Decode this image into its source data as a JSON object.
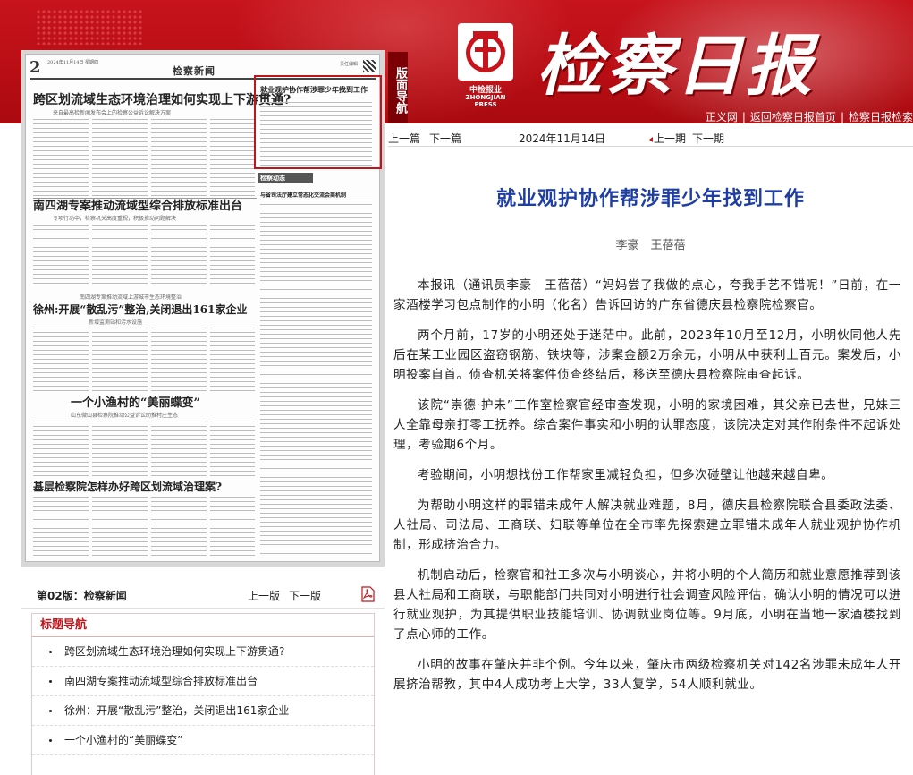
{
  "banner": {
    "masthead": "检察日报",
    "press_cn": "中检报业",
    "press_en": "ZHONGJIAN PRESS",
    "links": [
      "正义网",
      "返回检察日报首页",
      "检察日报检索"
    ]
  },
  "section_tab": "版面导航",
  "paper_thumb": {
    "page_no": "2",
    "date_line": "2024年11月14日 星期四",
    "section": "检察新闻",
    "hdr_right": "责任编辑",
    "headlines": [
      "跨区划流域生态环境治理如何实现上下游贯通?",
      "南四湖专案推动流域型综合排放标准出台",
      "徐州:开展“散乱污”整治,关闭退出161家企业",
      "一个小渔村的“美丽蝶变”",
      "基层检察院怎样办好跨区划流域治理案?",
      "就业观护协作帮涉罪少年找到工作",
      "与省司法厅建立常态化交流会商机制"
    ],
    "subheads": [
      "来自最高检新闻发布会上的检察公益诉讼解决方案",
      "专项行动中，检察机关高度重视，积极推动问题解决",
      "山东微山县检察院推动公益诉讼助推村庄生态",
      "南四湖专案推动流域上游城市生态环境整治",
      "新增监测站和污水设施"
    ],
    "jcdt": "检察动态"
  },
  "page_footer": {
    "info": "第02版：检察新闻",
    "prev": "上一版",
    "next": "下一版"
  },
  "title_nav": {
    "heading": "标题导航",
    "items": [
      "跨区划流域生态环境治理如何实现上下游贯通?",
      "南四湖专案推动流域型综合排放标准出台",
      "徐州：开展“散乱污”整治，关闭退出161家企业",
      "一个小渔村的“美丽蝶变”"
    ]
  },
  "toolbar": {
    "prev_article": "上一篇",
    "next_article": "下一篇",
    "date": "2024年11月14日",
    "prev_issue": "上一期",
    "next_issue": "下一期"
  },
  "article": {
    "title": "就业观护协作帮涉罪少年找到工作",
    "authors": "李豪　王蓓蓓",
    "paragraphs": [
      "本报讯（通讯员李豪　王蓓蓓）“妈妈尝了我做的点心，夸我手艺不错呢！”日前，在一家酒楼学习包点制作的小明（化名）告诉回访的广东省德庆县检察院检察官。",
      "两个月前，17岁的小明还处于迷茫中。此前，2023年10月至12月，小明伙同他人先后在某工业园区盗窃钢筋、铁块等，涉案金额2万余元，小明从中获利上百元。案发后，小明投案自首。侦查机关将案件侦查终结后，移送至德庆县检察院审查起诉。",
      "该院“崇德·护未”工作室检察官经审查发现，小明的家境困难，其父亲已去世，兄妹三人全靠母亲打零工抚养。综合案件事实和小明的认罪态度，该院决定对其作附条件不起诉处理，考验期6个月。",
      "考验期间，小明想找份工作帮家里减轻负担，但多次碰壁让他越来越自卑。",
      "为帮助小明这样的罪错未成年人解决就业难题，8月，德庆县检察院联合县委政法委、人社局、司法局、工商联、妇联等单位在全市率先探索建立罪错未成年人就业观护协作机制，形成挤治合力。",
      "机制启动后，检察官和社工多次与小明谈心，并将小明的个人简历和就业意愿推荐到该县人社局和工商联，与职能部门共同对小明进行社会调查风险评估，确认小明的情况可以进行就业观护，为其提供职业技能培训、协调就业岗位等。9月底，小明在当地一家酒楼找到了点心师的工作。",
      "小明的故事在肇庆并非个例。今年以来，肇庆市两级检察机关对142名涉罪未成年人开展挤治帮教，其中4人成功考上大学，33人复学，54人顺利就业。"
    ]
  },
  "colors": {
    "banner_red": "#c8141c",
    "title_blue": "#1f3ea3",
    "accent_red": "#c1151c"
  }
}
